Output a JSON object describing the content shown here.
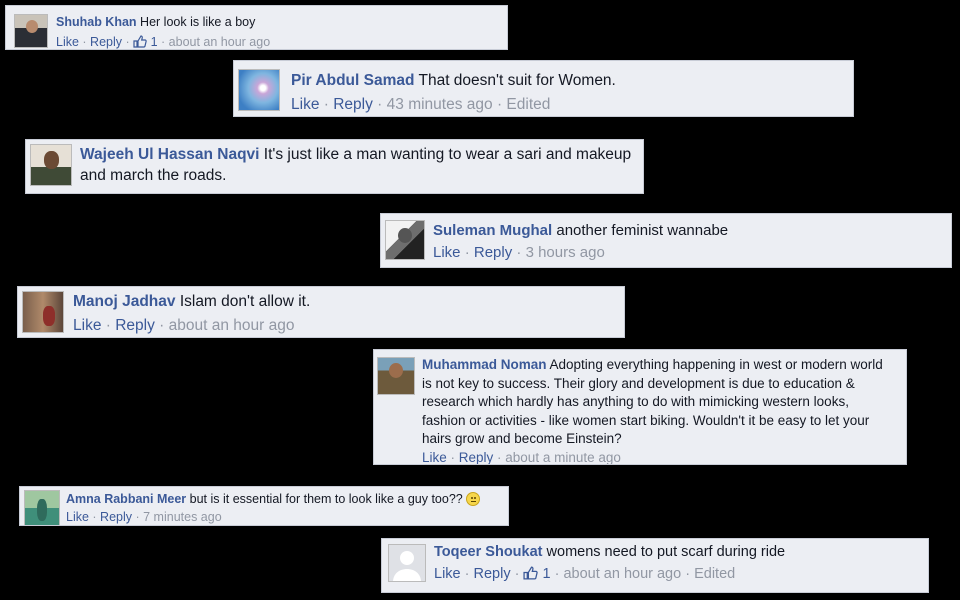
{
  "comments": [
    {
      "author": "Shuhab Khan",
      "text": "Her look is like a boy",
      "like": "Like",
      "reply": "Reply",
      "likes_count": "1",
      "time": "about an hour ago",
      "edited": ""
    },
    {
      "author": "Pir Abdul Samad",
      "text": "That doesn't suit for Women.",
      "like": "Like",
      "reply": "Reply",
      "likes_count": "",
      "time": "43 minutes ago",
      "edited": "Edited"
    },
    {
      "author": "Wajeeh Ul Hassan Naqvi",
      "text": "It's just like a man wanting to wear a sari and makeup and march the roads.",
      "like": "",
      "reply": "",
      "likes_count": "",
      "time": "",
      "edited": ""
    },
    {
      "author": "Suleman Mughal",
      "text": "another feminist wannabe",
      "like": "Like",
      "reply": "Reply",
      "likes_count": "",
      "time": "3 hours ago",
      "edited": ""
    },
    {
      "author": "Manoj Jadhav",
      "text": "Islam don't allow it.",
      "like": "Like",
      "reply": "Reply",
      "likes_count": "",
      "time": "about an hour ago",
      "edited": ""
    },
    {
      "author": "Muhammad Noman",
      "text": "Adopting everything happening in west or modern world is not key to success. Their glory and development is due to education & research which hardly has anything to do with mimicking western looks, fashion or activities - like women start biking. Wouldn't it be easy to let your hairs grow and become Einstein?",
      "like": "Like",
      "reply": "Reply",
      "likes_count": "",
      "time": "about a minute ago",
      "edited": ""
    },
    {
      "author": "Amna Rabbani Meer",
      "text": "but is it essential for them to look like a guy too??",
      "like": "Like",
      "reply": "Reply",
      "likes_count": "",
      "time": "7 minutes ago",
      "edited": "",
      "emoji": "confused-face-icon"
    },
    {
      "author": "Toqeer Shoukat",
      "text": "womens need to put scarf during ride",
      "like": "Like",
      "reply": "Reply",
      "likes_count": "1",
      "time": "about an hour ago",
      "edited": "Edited"
    }
  ],
  "colors": {
    "background": "#000000",
    "card": "#eceef3",
    "link": "#3b5998",
    "meta": "#9197a3",
    "text": "#141823"
  }
}
